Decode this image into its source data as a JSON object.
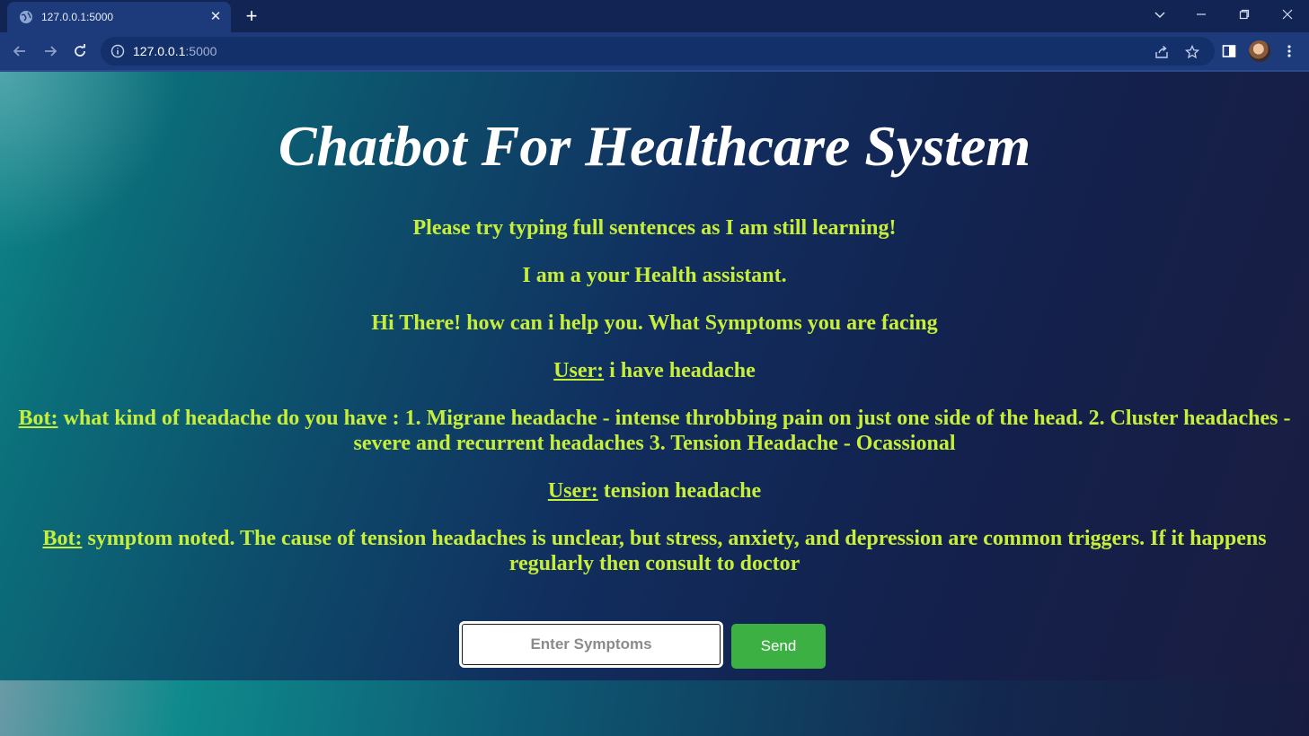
{
  "browser": {
    "tab_title": "127.0.0.1:5000",
    "url_host": "127.0.0.1",
    "url_port": ":5000"
  },
  "page": {
    "title": "Chatbot For Healthcare System",
    "messages": [
      {
        "speaker": "",
        "text": "Please try typing full sentences as I am still learning!"
      },
      {
        "speaker": "",
        "text": "I am a your Health assistant."
      },
      {
        "speaker": "",
        "text": "Hi There! how can i help you. What Symptoms you are facing"
      },
      {
        "speaker": "User:",
        "text": " i have headache"
      },
      {
        "speaker": "Bot:",
        "text": " what kind of headache do you have : 1. Migrane headache - intense throbbing pain on just one side of the head. 2. Cluster headaches - severe and recurrent headaches 3. Tension Headache - Ocassional"
      },
      {
        "speaker": "User:",
        "text": " tension headache"
      },
      {
        "speaker": "Bot:",
        "text": " symptom noted. The cause of tension headaches is unclear, but stress, anxiety, and depression are common triggers. If it happens regularly then consult to doctor"
      }
    ],
    "input_placeholder": "Enter Symptoms",
    "send_label": "Send"
  },
  "colors": {
    "message_text": "#c7ef3a",
    "title_text": "#ffffff",
    "send_button": "#3cb043"
  }
}
